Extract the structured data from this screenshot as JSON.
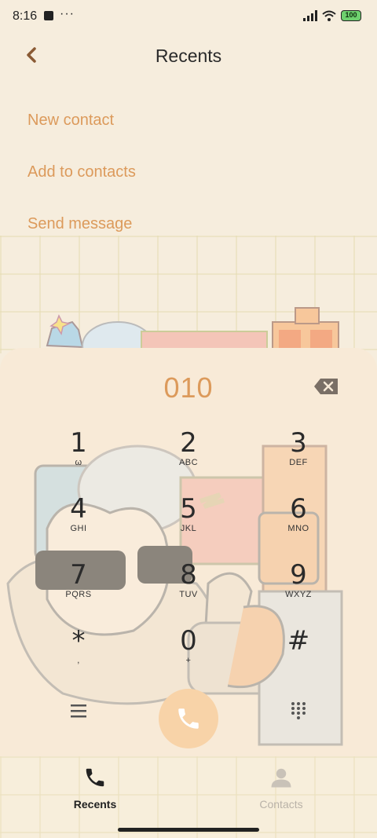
{
  "status_bar": {
    "time": "8:16",
    "dots": "···",
    "battery": "100"
  },
  "header": {
    "title": "Recents"
  },
  "menu": {
    "new_contact": "New contact",
    "add_to_contacts": "Add to contacts",
    "send_message": "Send message"
  },
  "dialer": {
    "number": "010",
    "keys": [
      {
        "digit": "1",
        "letters": "ω"
      },
      {
        "digit": "2",
        "letters": "ABC"
      },
      {
        "digit": "3",
        "letters": "DEF"
      },
      {
        "digit": "4",
        "letters": "GHI"
      },
      {
        "digit": "5",
        "letters": "JKL"
      },
      {
        "digit": "6",
        "letters": "MNO"
      },
      {
        "digit": "7",
        "letters": "PQRS"
      },
      {
        "digit": "8",
        "letters": "TUV"
      },
      {
        "digit": "9",
        "letters": "WXYZ"
      },
      {
        "digit": "*",
        "letters": ","
      },
      {
        "digit": "0",
        "letters": "+"
      },
      {
        "digit": "#",
        "letters": ""
      }
    ]
  },
  "bottom_nav": {
    "recents": "Recents",
    "contacts": "Contacts"
  },
  "colors": {
    "accent": "#dc9a5b",
    "call_button": "#f8d3a8",
    "background": "#f6eddd"
  }
}
